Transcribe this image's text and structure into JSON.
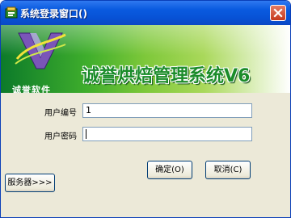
{
  "window": {
    "title": "系统登录窗口()"
  },
  "banner": {
    "logo_text": "诚誉软件",
    "product_title": "诚誉烘焙管理系统V6"
  },
  "form": {
    "user_id_label": "用户编号",
    "user_id_value": "1",
    "password_label": "用户密码",
    "password_value": ""
  },
  "buttons": {
    "ok_label": "确定(O)",
    "cancel_label": "取消(C)",
    "server_label": "服务器>>>"
  },
  "colors": {
    "titlebar": "#0a5be0",
    "banner_green": "#3fae2c",
    "title_text_green": "#1b8c2a"
  }
}
